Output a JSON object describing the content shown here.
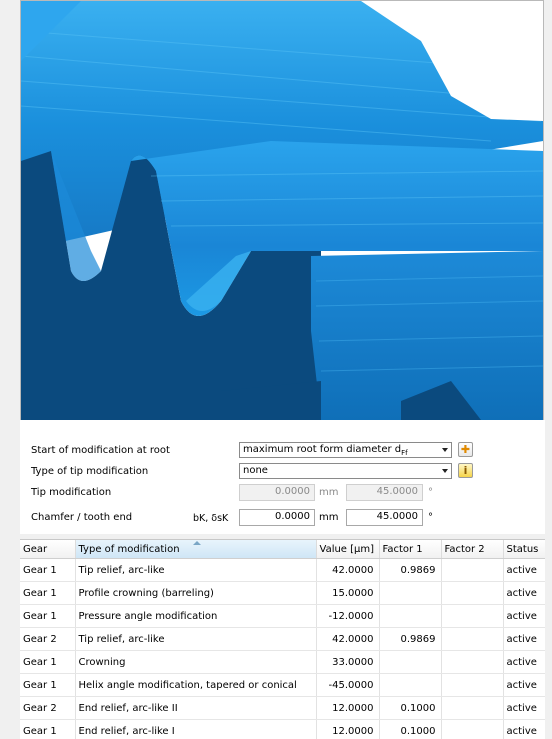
{
  "form": {
    "root_label": "Start of modification at root",
    "root_value": "maximum root form diameter d",
    "root_sub": "Ff",
    "tip_type_label": "Type of tip modification",
    "tip_type_value": "none",
    "tip_mod_label": "Tip modification",
    "tip_mod_value1": "0.0000",
    "tip_mod_unit1": "mm",
    "tip_mod_value2": "45.0000",
    "tip_mod_unit2": "°",
    "chamfer_label": "Chamfer / tooth end",
    "chamfer_symbol": "bK, δsK",
    "chamfer_value1": "0.0000",
    "chamfer_unit1": "mm",
    "chamfer_value2": "45.0000",
    "chamfer_unit2": "°",
    "plus_icon": "plus-icon",
    "info_icon": "info-icon"
  },
  "table": {
    "headers": [
      "Gear",
      "Type of modification",
      "Value [µm]",
      "Factor 1",
      "Factor 2",
      "Status"
    ],
    "rows": [
      {
        "gear": "Gear 1",
        "type": "Tip relief, arc-like",
        "value": "42.0000",
        "f1": "0.9869",
        "f2": "",
        "status": "active"
      },
      {
        "gear": "Gear 1",
        "type": "Profile crowning (barreling)",
        "value": "15.0000",
        "f1": "",
        "f2": "",
        "status": "active"
      },
      {
        "gear": "Gear 1",
        "type": "Pressure angle modification",
        "value": "-12.0000",
        "f1": "",
        "f2": "",
        "status": "active"
      },
      {
        "gear": "Gear 2",
        "type": "Tip relief, arc-like",
        "value": "42.0000",
        "f1": "0.9869",
        "f2": "",
        "status": "active"
      },
      {
        "gear": "Gear 1",
        "type": "Crowning",
        "value": "33.0000",
        "f1": "",
        "f2": "",
        "status": "active"
      },
      {
        "gear": "Gear 1",
        "type": "Helix angle modification, tapered or conical",
        "value": "-45.0000",
        "f1": "",
        "f2": "",
        "status": "active"
      },
      {
        "gear": "Gear 2",
        "type": "End relief, arc-like II",
        "value": "12.0000",
        "f1": "0.1000",
        "f2": "",
        "status": "active"
      },
      {
        "gear": "Gear 1",
        "type": "End relief, arc-like I",
        "value": "12.0000",
        "f1": "0.1000",
        "f2": "",
        "status": "active"
      }
    ]
  },
  "colors": {
    "gear_light": "#1e9be6",
    "gear_dark": "#0a4e84",
    "gear_mid": "#1684cf"
  }
}
